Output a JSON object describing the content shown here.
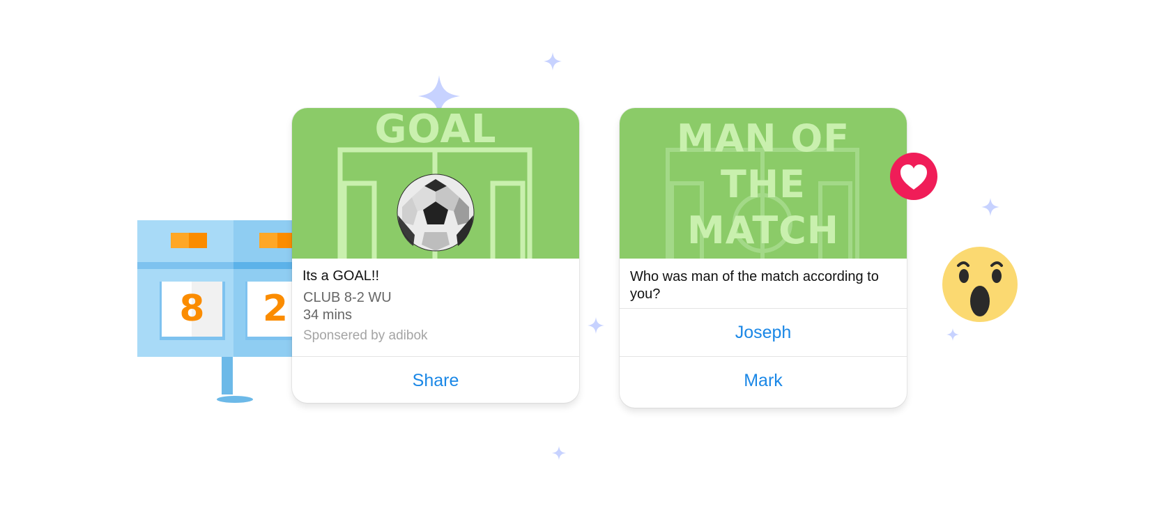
{
  "colors": {
    "pitch_green": "#8bcb68",
    "pitch_lines": "#c9f0ae",
    "action_blue": "#1a87e6",
    "scoreboard_blue": "#a8daf7",
    "score_orange": "#fb8c00",
    "heart_red": "#f01d58",
    "emoji_yellow": "#fbd971",
    "sparkle": "#c7d2ff"
  },
  "scoreboard": {
    "home_score": "8",
    "away_score": "2",
    "icon": "scoreboard-icon"
  },
  "goal_card": {
    "hero_title": "GOAL",
    "title": "Its a GOAL!!",
    "score_line": "CLUB 8-2 WU",
    "time": "34 mins",
    "sponsor": "Sponsered by adibok",
    "action_label": "Share",
    "icon": "soccer-ball-icon"
  },
  "poll_card": {
    "hero_title_lines": [
      "MAN OF",
      "THE",
      "MATCH"
    ],
    "question": "Who was man of the match according to you?",
    "options": [
      "Joseph",
      "Mark"
    ]
  },
  "reactions": {
    "heart": "heart-icon",
    "wow": "wow-emoji-icon"
  }
}
